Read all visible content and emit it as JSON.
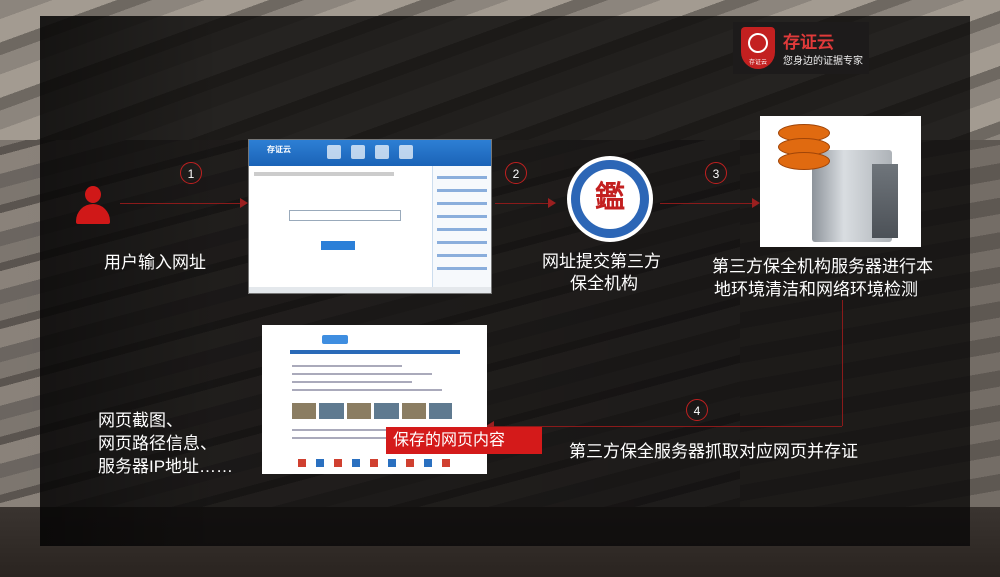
{
  "brand": {
    "name": "存证云",
    "slogan": "您身边的证据专家",
    "shield_text": "存证云"
  },
  "steps": [
    {
      "num": "1"
    },
    {
      "num": "2"
    },
    {
      "num": "3"
    },
    {
      "num": "4"
    }
  ],
  "labels": {
    "user_input": "用户输入网址",
    "submit_line1": "网址提交第三方",
    "submit_line2": "保全机构",
    "server_line1": "第三方保全机构服务器进行本",
    "server_line2": "地环境清洁和网络环境检测",
    "capture": "第三方保全服务器抓取对应网页并存证",
    "saved_content": "保存的网页内容",
    "evidence_line1": "网页截图、",
    "evidence_line2": "网页路径信息、",
    "evidence_line3": "服务器IP地址……"
  },
  "app_window": {
    "title": "存证云"
  },
  "seal": {
    "center": "鑑"
  },
  "colors": {
    "accent": "#d01818",
    "seal_blue": "#2c66b6",
    "app_blue": "#1b63b7",
    "db_orange": "#e06a10"
  }
}
